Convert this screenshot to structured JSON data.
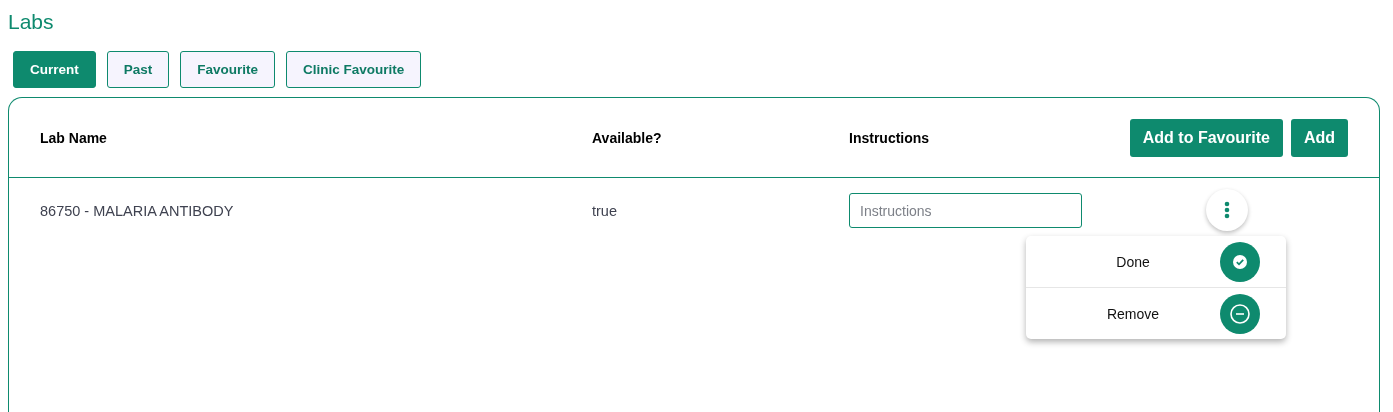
{
  "title": "Labs",
  "tabs": [
    {
      "label": "Current",
      "selected": true
    },
    {
      "label": "Past",
      "selected": false
    },
    {
      "label": "Favourite",
      "selected": false
    },
    {
      "label": "Clinic Favourite",
      "selected": false
    }
  ],
  "table": {
    "columns": [
      "Lab Name",
      "Available?",
      "Instructions"
    ],
    "header_buttons": [
      "Add to Favourite",
      "Add"
    ],
    "rows": [
      {
        "lab_name": "86750 - MALARIA ANTIBODY",
        "available": "true",
        "instructions": {
          "placeholder": "Instructions"
        }
      }
    ]
  },
  "row_menu": {
    "items": [
      {
        "label": "Done",
        "kind": "done"
      },
      {
        "label": "Remove",
        "kind": "remove"
      }
    ]
  }
}
